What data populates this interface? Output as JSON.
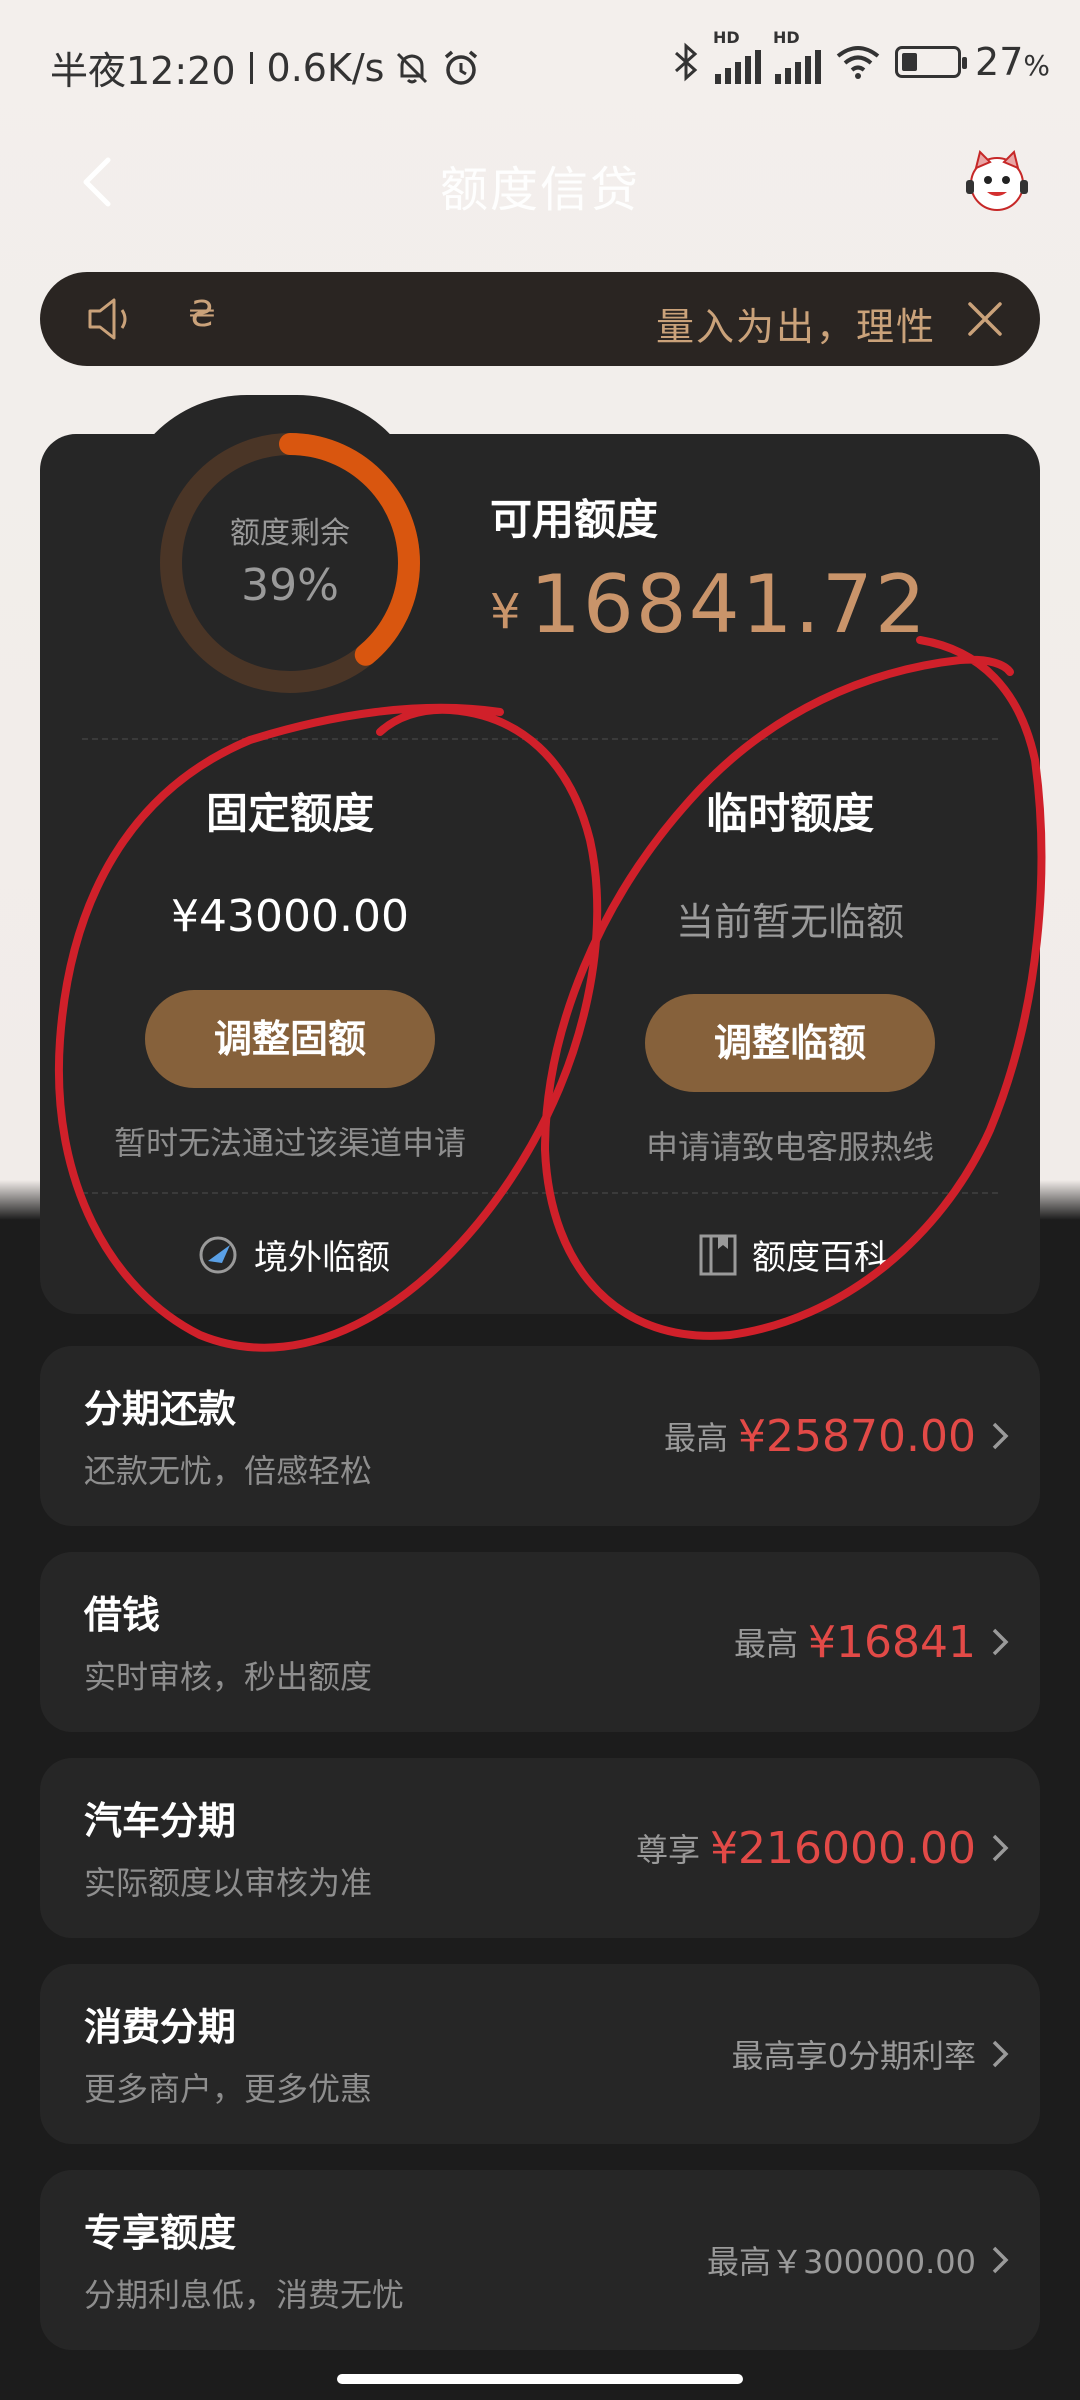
{
  "status": {
    "time": "半夜12:20",
    "speed": "0.6K/s",
    "battery": "27",
    "battery_unit": "%",
    "hd1": "HD",
    "hd2": "HD",
    "icons": [
      "mute-bell-icon",
      "alarm-icon",
      "bluetooth-icon",
      "signal-icon",
      "wifi-icon",
      "battery-icon"
    ]
  },
  "header": {
    "title": "额度信贷",
    "back_icon": "back-arrow-icon",
    "mascot_icon": "mascot-avatar-icon"
  },
  "notice": {
    "prefix": "₴",
    "text": "量入为出，理性",
    "close_icon": "close-icon"
  },
  "summary": {
    "ring_label": "额度剩余",
    "ring_pct_text": "39%",
    "ring_pct": 39,
    "available_label": "可用额度",
    "currency": "¥",
    "available_amount": "16841.72"
  },
  "fixed": {
    "title": "固定额度",
    "value": "¥43000.00",
    "button": "调整固额",
    "note": "暂时无法通过该渠道申请",
    "link": "境外临额"
  },
  "temp": {
    "title": "临时额度",
    "value": "当前暂无临额",
    "button": "调整临额",
    "note": "申请请致电客服热线",
    "link": "额度百科"
  },
  "list": [
    {
      "title": "分期还款",
      "sub": "还款无忧，倍感轻松",
      "pre": "最高",
      "amount": "¥25870.00"
    },
    {
      "title": "借钱",
      "sub": "实时审核，秒出额度",
      "pre": "最高",
      "amount": "¥16841"
    },
    {
      "title": "汽车分期",
      "sub": "实际额度以审核为准",
      "pre": "尊享",
      "amount": "¥216000.00"
    },
    {
      "title": "消费分期",
      "sub": "更多商户，更多优惠",
      "text": "最高享0分期利率"
    },
    {
      "title": "专享额度",
      "sub": "分期利息低，消费无忧",
      "text": "最高￥300000.00"
    }
  ],
  "colors": {
    "accent_gold": "#c9946a",
    "button_brown": "#86613b",
    "ring_orange": "#d9560f",
    "ring_track": "#4a3526",
    "amount_red": "#e24a47",
    "annotation_red": "#d0202a"
  }
}
